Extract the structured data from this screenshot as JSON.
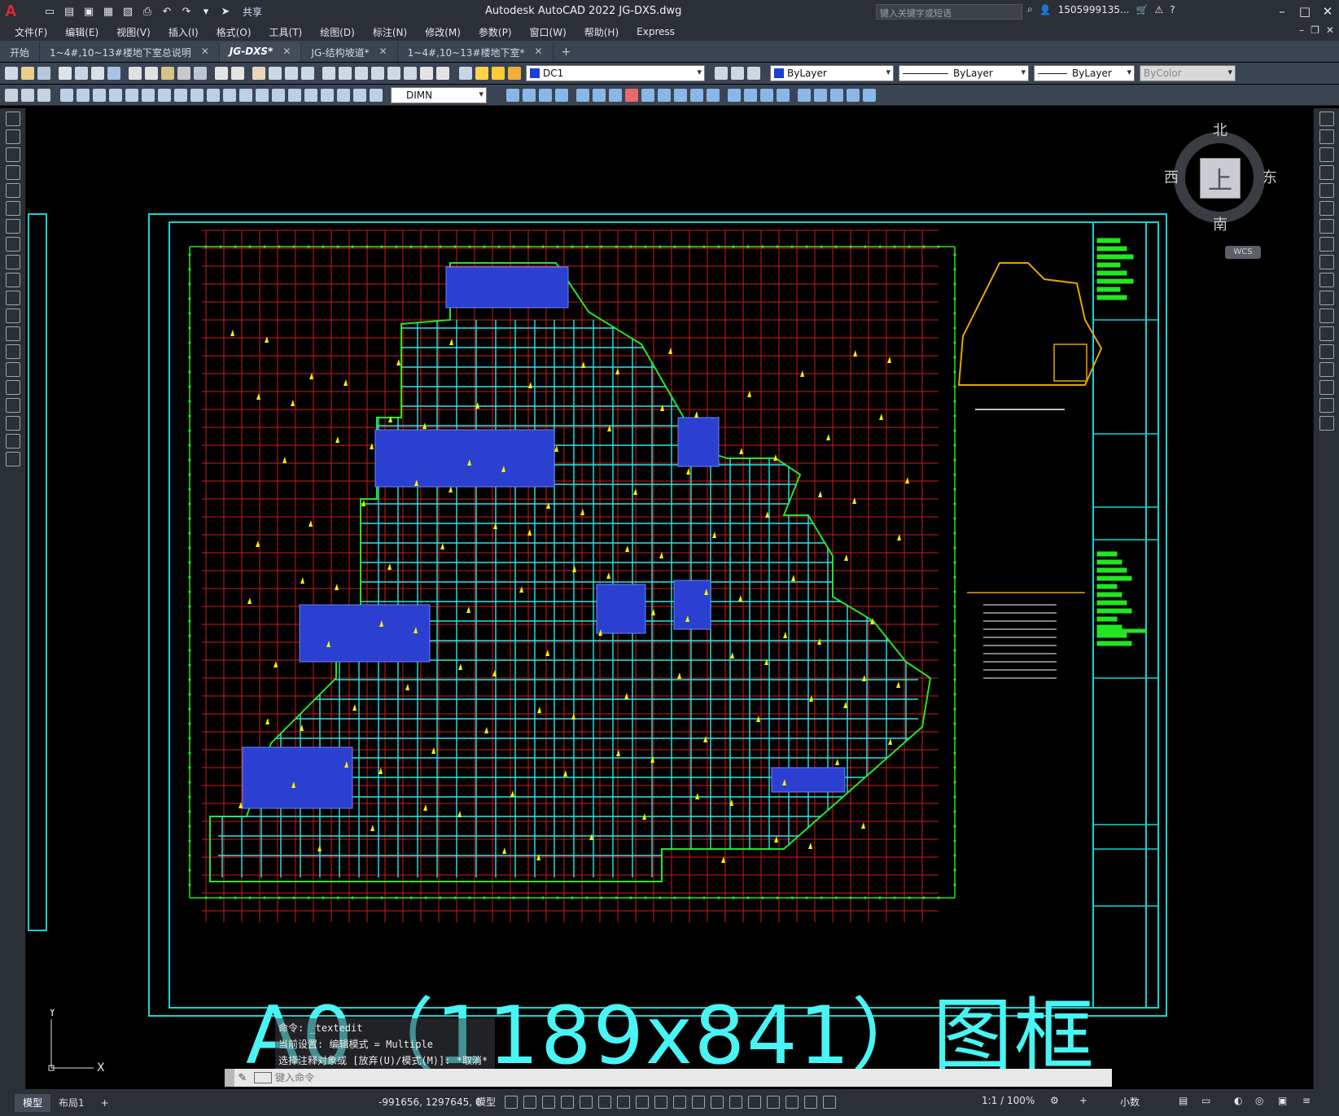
{
  "app": {
    "logo": "A",
    "title": "Autodesk AutoCAD 2022    JG-DXS.dwg",
    "share_label": "共享",
    "search_placeholder": "键入关键字或短语",
    "user": "1505999135...",
    "window_controls": [
      "–",
      "□",
      "✕"
    ]
  },
  "menu": {
    "items": [
      "文件(F)",
      "编辑(E)",
      "视图(V)",
      "插入(I)",
      "格式(O)",
      "工具(T)",
      "绘图(D)",
      "标注(N)",
      "修改(M)",
      "参数(P)",
      "窗口(W)",
      "帮助(H)",
      "Express"
    ]
  },
  "tabs": {
    "items": [
      {
        "label": "开始",
        "close": ""
      },
      {
        "label": "1~4#,10~13#楼地下室总说明",
        "close": "✕"
      },
      {
        "label": "JG-DXS*",
        "close": "✕"
      },
      {
        "label": "JG-结构坡道*",
        "close": "✕"
      },
      {
        "label": "1~4#,10~13#楼地下室*",
        "close": "✕"
      }
    ],
    "add": "+"
  },
  "toolbar": {
    "layer": "DC1",
    "color": "ByLayer",
    "linetype": "ByLayer",
    "lineweight": "ByLayer",
    "plotstyle": "ByColor",
    "dimstyle": "DIMN"
  },
  "viewcube": {
    "north": "北",
    "south": "南",
    "east": "东",
    "west": "西",
    "top": "上",
    "wcs": "WCS"
  },
  "drawing": {
    "overlay_text": "A0（1189x841）图框"
  },
  "command": {
    "history": [
      "命令: _textedit",
      "当前设置: 编辑模式 = Multiple",
      "选择注释对象或 [放弃(U)/模式(M)]: *取消*"
    ],
    "placeholder": "键入命令"
  },
  "status": {
    "tabs": [
      "模型",
      "布局1"
    ],
    "add": "+",
    "coords": "-991656, 1297645, 0",
    "model_label": "模型",
    "scale": "1:1 / 100%",
    "units": "小数"
  },
  "colors": {
    "grid_red": "#d11a1a",
    "beam_cyan": "#2de6e6",
    "wall_green": "#22e622",
    "text_yellow": "#f5f000",
    "hatch_blue": "#2b3fd0",
    "frame_cyan": "#17d3d3"
  }
}
